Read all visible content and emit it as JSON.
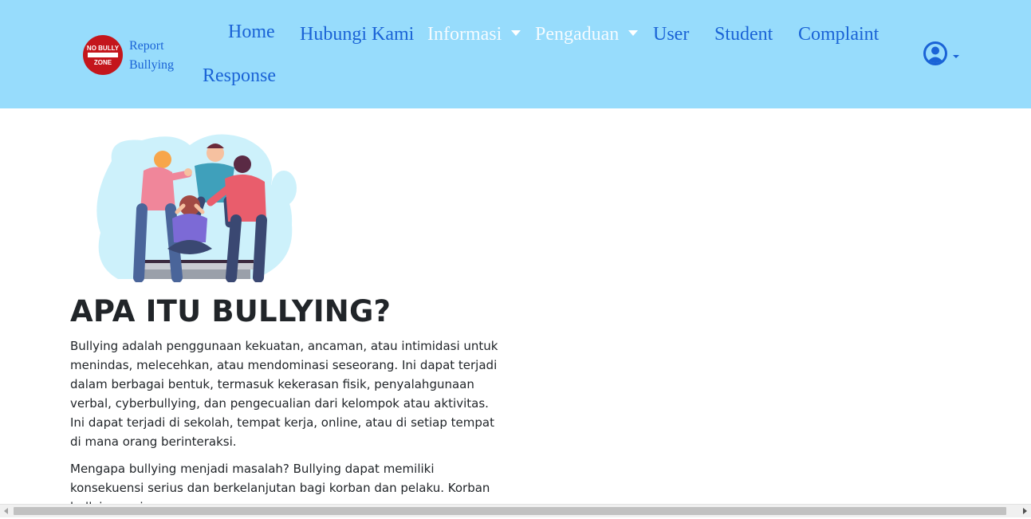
{
  "brand": {
    "logo_top": "NO BULLY",
    "logo_bottom": "ZONE",
    "line1": "Report",
    "line2": "Bullying",
    "logo_color": "#c4161c"
  },
  "nav": {
    "home": "Home",
    "contact": "Hubungi Kami",
    "info": "Informasi",
    "complaints_menu": "Pengaduan",
    "user": "User",
    "student": "Student",
    "complaint": "Complaint",
    "response": "Response",
    "user_icon": "user-circle-icon"
  },
  "article": {
    "title": "APA ITU BULLYING?",
    "paragraphs": [
      "Bullying adalah penggunaan kekuatan, ancaman, atau intimidasi untuk menindas, melecehkan, atau mendominasi seseorang. Ini dapat terjadi dalam berbagai bentuk, termasuk kekerasan fisik, penyalahgunaan verbal, cyberbullying, dan pengecualian dari kelompok atau aktivitas. Ini dapat terjadi di sekolah, tempat kerja, online, atau di setiap tempat di mana orang berinteraksi.",
      "Mengapa bullying menjadi masalah? Bullying dapat memiliki konsekuensi serius dan berkelanjutan bagi korban dan pelaku. Korban bullying sering"
    ]
  },
  "colors": {
    "navbar_bg": "#97dcfc",
    "link": "#1a63d6",
    "text": "#212529"
  }
}
